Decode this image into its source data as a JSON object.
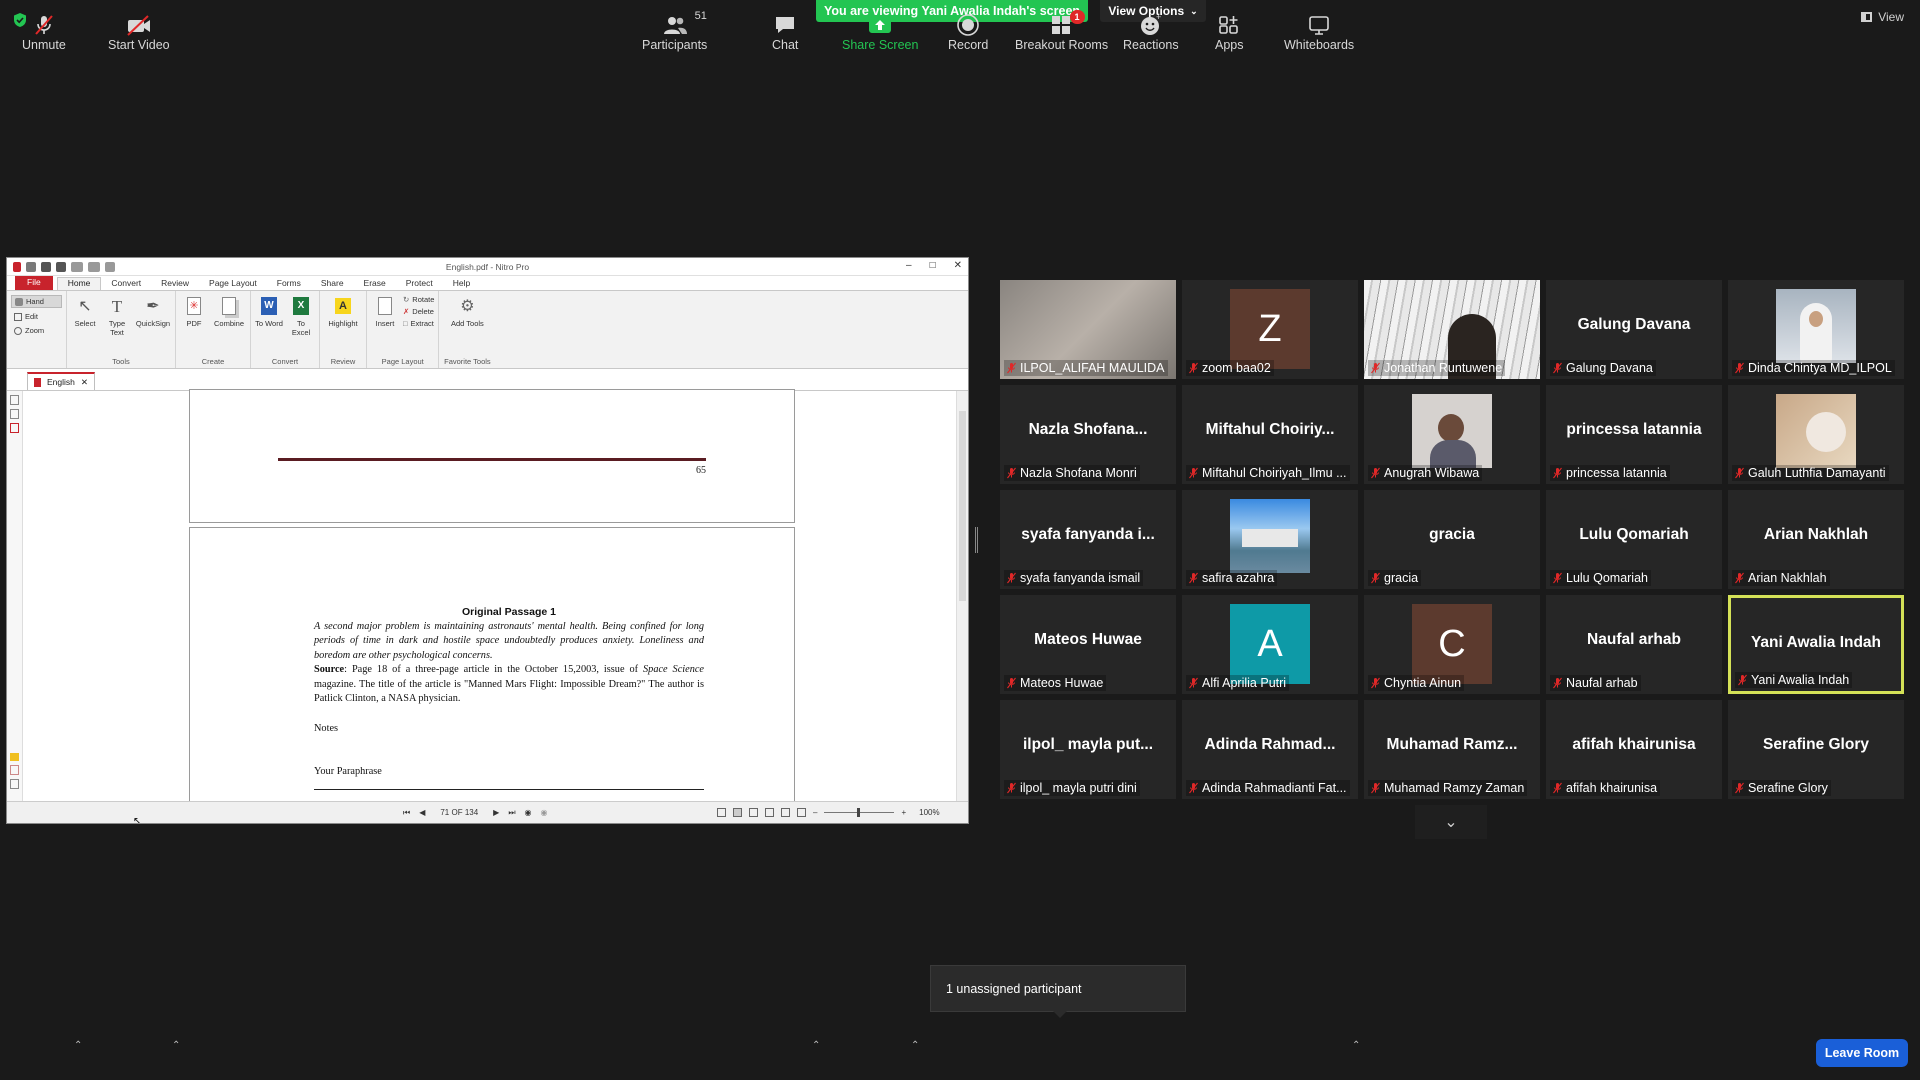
{
  "banner": {
    "text": "You are viewing Yani Awalia Indah's screen",
    "view_options": "View Options",
    "view": "View"
  },
  "shared": {
    "window_title": "English.pdf - Nitro Pro",
    "menu": [
      "File",
      "Home",
      "Convert",
      "Review",
      "Page Layout",
      "Forms",
      "Share",
      "Erase",
      "Protect",
      "Help"
    ],
    "ribbon": {
      "hand": "Hand",
      "edit": "Edit",
      "zoom": "Zoom",
      "select": "Select",
      "type_text": "Type Text",
      "quicksign": "QuickSign",
      "tools_group": "Tools",
      "pdf": "PDF",
      "combine": "Combine",
      "create_group": "Create",
      "to_word": "To Word",
      "to_excel": "To Excel",
      "convert_group": "Convert",
      "highlight": "Highlight",
      "review_group": "Review",
      "insert": "Insert",
      "rotate": "Rotate",
      "delete": "Delete",
      "extract": "Extract",
      "layout_group": "Page Layout",
      "add_tools": "Add Tools",
      "fav_group": "Favorite Tools"
    },
    "doc_tab": "English",
    "page_number": "65",
    "passage_title": "Original Passage 1",
    "passage_body": "A second major problem is maintaining astronauts' mental health. Being confined for long periods of time in dark and hostile space undoubtedly produces anxiety. Loneliness and boredom are other psychological concerns.",
    "source_label": "Source",
    "source_text_a": ": Page 18 of a three-page article in the October 15,2003, issue of ",
    "source_mag": "Space Science",
    "source_text_b": " magazine. The title of the article is \"Manned Mars Flight: Impossible Dream?\" The author is Patlick Clinton, a NASA physician.",
    "notes": "Notes",
    "your_paraphrase": "Your Paraphrase",
    "page_indicator": "71 OF 134",
    "zoom": "100%"
  },
  "participants": [
    {
      "display": "",
      "label": "ILPOL_ALIFAH MAULIDA",
      "kind": "blur"
    },
    {
      "display": "Z",
      "label": "zoom baa02",
      "kind": "avatar",
      "color": "#5c3a2e"
    },
    {
      "display": "",
      "label": "Jonathan Runtuwene",
      "kind": "manga"
    },
    {
      "display": "Galung Davana",
      "label": "Galung Davana",
      "kind": "name"
    },
    {
      "display": "",
      "label": "Dinda Chintya MD_ILPOL",
      "kind": "photo-hijab"
    },
    {
      "display": "Nazla  Shofana...",
      "label": "Nazla Shofana Monri",
      "kind": "name"
    },
    {
      "display": "Miftahul  Choiriy...",
      "label": "Miftahul Choiriyah_Ilmu ...",
      "kind": "name"
    },
    {
      "display": "",
      "label": "Anugrah Wibawa",
      "kind": "photo-person"
    },
    {
      "display": "princessa latannia",
      "label": "princessa latannia",
      "kind": "name"
    },
    {
      "display": "",
      "label": "Galuh Luthfia Damayanti",
      "kind": "photo-cat"
    },
    {
      "display": "syafa fanyanda i...",
      "label": "syafa fanyanda ismail",
      "kind": "name"
    },
    {
      "display": "",
      "label": "safira azahra",
      "kind": "photo-room"
    },
    {
      "display": "gracia",
      "label": "gracia",
      "kind": "name"
    },
    {
      "display": "Lulu Qomariah",
      "label": "Lulu Qomariah",
      "kind": "name"
    },
    {
      "display": "Arian Nakhlah",
      "label": "Arian Nakhlah",
      "kind": "name"
    },
    {
      "display": "Mateos Huwae",
      "label": "Mateos Huwae",
      "kind": "name"
    },
    {
      "display": "A",
      "label": "Alfi Aprilia Putri",
      "kind": "avatar",
      "color": "#0e9aa7"
    },
    {
      "display": "C",
      "label": "Chyntia Ainun",
      "kind": "avatar",
      "color": "#5c3a2e"
    },
    {
      "display": "Naufal arhab",
      "label": "Naufal arhab",
      "kind": "name"
    },
    {
      "display": "Yani Awalia Indah",
      "label": "Yani Awalia Indah",
      "kind": "name",
      "active": true
    },
    {
      "display": "ilpol_  mayla  put...",
      "label": "ilpol_ mayla putri dini",
      "kind": "name"
    },
    {
      "display": "Adinda  Rahmad...",
      "label": "Adinda Rahmadianti Fat...",
      "kind": "name"
    },
    {
      "display": "Muhamad  Ramz...",
      "label": "Muhamad Ramzy Zaman",
      "kind": "name"
    },
    {
      "display": "afifah khairunisa",
      "label": "afifah khairunisa",
      "kind": "name"
    },
    {
      "display": "Serafine Glory",
      "label": "Serafine Glory",
      "kind": "name"
    }
  ],
  "tooltip": "1 unassigned participant",
  "toolbar": {
    "unmute": "Unmute",
    "start_video": "Start Video",
    "participants": "Participants",
    "participants_count": "51",
    "chat": "Chat",
    "share_screen": "Share Screen",
    "record": "Record",
    "breakout_rooms": "Breakout Rooms",
    "breakout_badge": "1",
    "reactions": "Reactions",
    "apps": "Apps",
    "whiteboards": "Whiteboards",
    "leave_room": "Leave Room"
  },
  "colors": {
    "share_green": "#23c552",
    "leave_blue": "#1a5fd8",
    "active_speaker": "#d4e157",
    "muted_red": "#e02828"
  }
}
